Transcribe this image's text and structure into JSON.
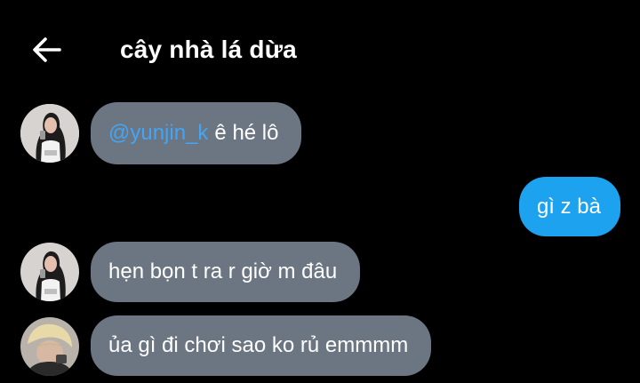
{
  "header": {
    "back_icon": "arrow-left-icon",
    "title": "cây nhà lá dừa"
  },
  "messages": [
    {
      "direction": "incoming",
      "avatar_icon": "user-avatar-1",
      "mention": "@yunjin_k",
      "text": "ê hé lô"
    },
    {
      "direction": "outgoing",
      "text": "gì z bà"
    },
    {
      "direction": "incoming",
      "avatar_icon": "user-avatar-1",
      "text": "hẹn bọn t ra r giờ m đâu"
    },
    {
      "direction": "incoming",
      "avatar_icon": "user-avatar-2",
      "text": "ủa gì đi chơi sao ko rủ emmmm"
    }
  ],
  "colors": {
    "background": "#000000",
    "incoming_bubble": "#6c7582",
    "outgoing_bubble": "#1ca2ee",
    "mention": "#42a5f5",
    "text": "#ffffff"
  }
}
